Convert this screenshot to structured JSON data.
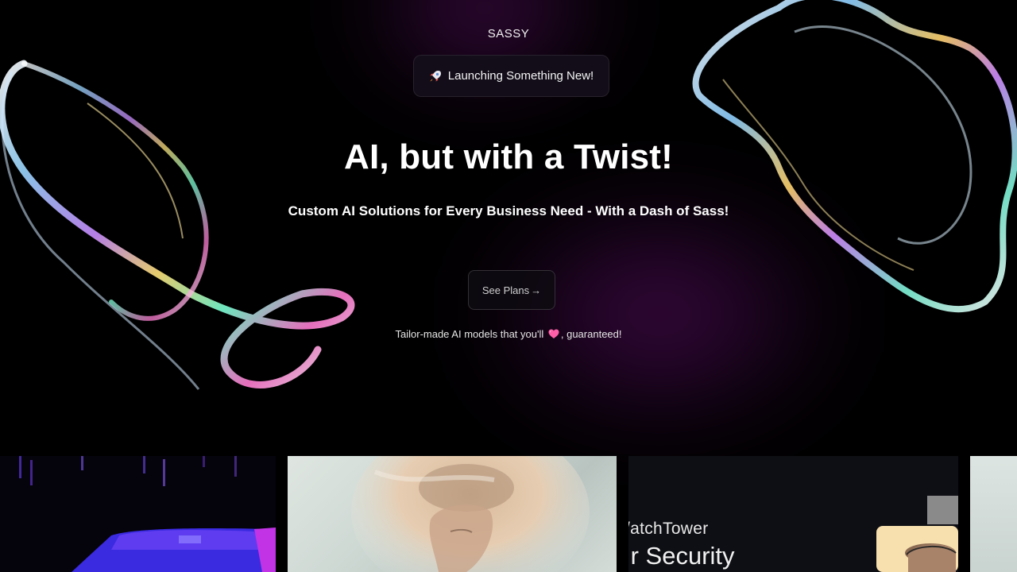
{
  "brand": {
    "name": "SASSY"
  },
  "badge": {
    "icon": "rocket-icon",
    "label": "Launching Something New!"
  },
  "hero": {
    "title": "AI, but with a Twist!",
    "subtitle": "Custom AI Solutions for Every Business Need - With a Dash of Sass!"
  },
  "cta": {
    "label": "See Plans",
    "icon": "arrow-right-icon",
    "arrow": "→"
  },
  "tagline": {
    "before": "Tailor-made AI models that you'll",
    "icon": "heart-icon",
    "after": ", guaranteed!"
  },
  "gallery": {
    "cards": [
      {
        "name": "retro-car-card"
      },
      {
        "name": "portrait-card"
      },
      {
        "name": "watchtower-card",
        "title": "/atchTower",
        "subtitle": "ır Security"
      },
      {
        "name": "partial-card"
      }
    ]
  },
  "colors": {
    "background": "#000000",
    "glow": "#6e1478",
    "heart": "#ff5fa8"
  }
}
